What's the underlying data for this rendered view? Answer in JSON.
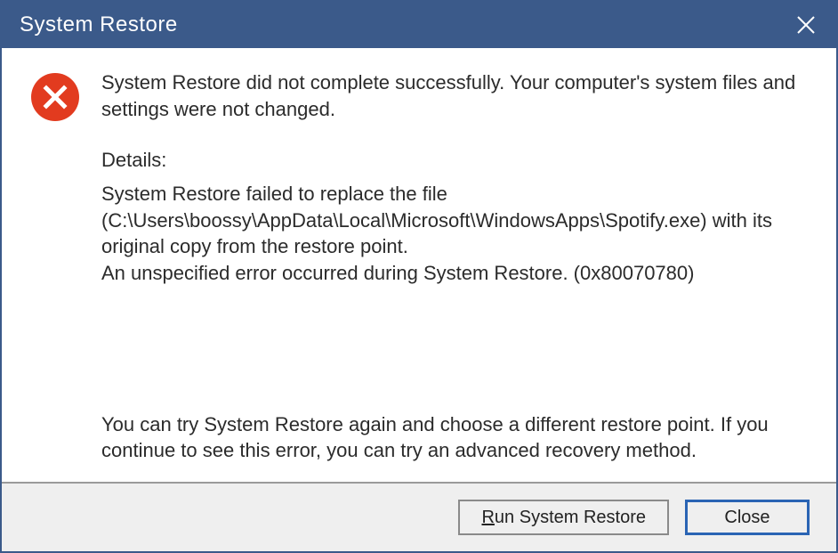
{
  "window": {
    "title": "System Restore"
  },
  "message": {
    "summary": "System Restore did not complete successfully. Your computer's system files and settings were not changed.",
    "details_label": "Details:",
    "details_body": "System Restore failed to replace the file (C:\\Users\\boossy\\AppData\\Local\\Microsoft\\WindowsApps\\Spotify.exe) with its original copy from the restore point.\nAn unspecified error occurred during System Restore. (0x80070780)",
    "advice": "You can try System Restore again and choose a different restore point. If you continue to see this error, you can try an advanced recovery method."
  },
  "buttons": {
    "run_mnemonic": "R",
    "run_rest": "un System Restore",
    "close": "Close"
  }
}
